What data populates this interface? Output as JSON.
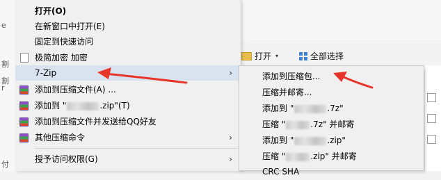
{
  "background": {
    "left_chars": [
      "e",
      "割",
      "割",
      "r",
      "付"
    ],
    "ribbon_open_label": "打开",
    "ribbon_selectall_label": "全部选择"
  },
  "menu": {
    "items": [
      {
        "label": "打开(O)"
      },
      {
        "label": "在新窗口中打开(E)"
      },
      {
        "label": "固定到快速访问"
      },
      {
        "label": "极简加密 加密"
      },
      {
        "label": "7-Zip"
      },
      {
        "label": "添加到压缩文件(A) ..."
      },
      {
        "label_prefix": "添加到 \"",
        "label_suffix": ".zip\"(T)"
      },
      {
        "label": "添加到压缩文件并发送给QQ好友"
      },
      {
        "label": "其他压缩命令"
      },
      {
        "label": "授予访问权限(G)"
      }
    ]
  },
  "submenu": {
    "items": [
      {
        "label": "添加到压缩包..."
      },
      {
        "label": "压缩并邮寄..."
      },
      {
        "label_prefix": "添加到 \"",
        "label_suffix": ".7z\""
      },
      {
        "label_prefix": "压缩 \"",
        "label_suffix": ".7z\" 并邮寄"
      },
      {
        "label_prefix": "添加到 \"",
        "label_suffix": ".zip\""
      },
      {
        "label_prefix": "压缩 \"",
        "label_suffix": ".zip\" 并邮寄"
      },
      {
        "label": "CRC SHA"
      }
    ]
  },
  "colors": {
    "annotation_arrow": "#e8352a",
    "menu_highlight": "#d9e3f0",
    "menu_bg": "#f0f0f0"
  },
  "icons": {
    "winrar": "winrar-icon",
    "document": "document-icon",
    "submenu_arrow": "chevron-right-icon"
  }
}
